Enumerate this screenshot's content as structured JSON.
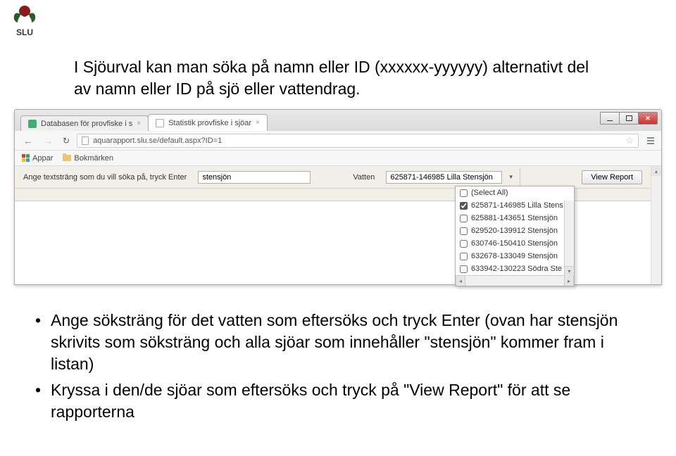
{
  "intro": "I Sjöurval kan man söka på namn eller ID (xxxxxx-yyyyyy) alternativt del av namn eller ID på sjö eller vattendrag.",
  "browser": {
    "tabs": [
      {
        "title": "Databasen för provfiske i s"
      },
      {
        "title": "Statistik provfiske i sjöar"
      }
    ],
    "url": "aquarapport.slu.se/default.aspx?ID=1",
    "bookmarks": {
      "apps": "Appar",
      "folder": "Bokmärken"
    }
  },
  "toolbar": {
    "search_label": "Ange textsträng som du vill söka på, tryck Enter",
    "search_value": "stensjön",
    "vatten_label": "Vatten",
    "vatten_value": "625871-146985 Lilla Stensjön",
    "view_report": "View Report"
  },
  "dropdown": {
    "items": [
      {
        "label": "(Select All)",
        "checked": false
      },
      {
        "label": "625871-146985 Lilla Stens",
        "checked": true
      },
      {
        "label": "625881-143651 Stensjön",
        "checked": false
      },
      {
        "label": "629520-139912 Stensjön",
        "checked": false
      },
      {
        "label": "630746-150410 Stensjön",
        "checked": false
      },
      {
        "label": "632678-133049 Stensjön",
        "checked": false
      },
      {
        "label": "633942-130223 Södra Ste",
        "checked": false
      }
    ]
  },
  "bullets": {
    "b1": "Ange söksträng för det vatten som eftersöks och tryck Enter (ovan har stensjön skrivits som söksträng och alla sjöar som innehåller \"stensjön\" kommer fram i listan)",
    "b2": "Kryssa i den/de sjöar som eftersöks och tryck på \"View Report\" för att se rapporterna"
  }
}
